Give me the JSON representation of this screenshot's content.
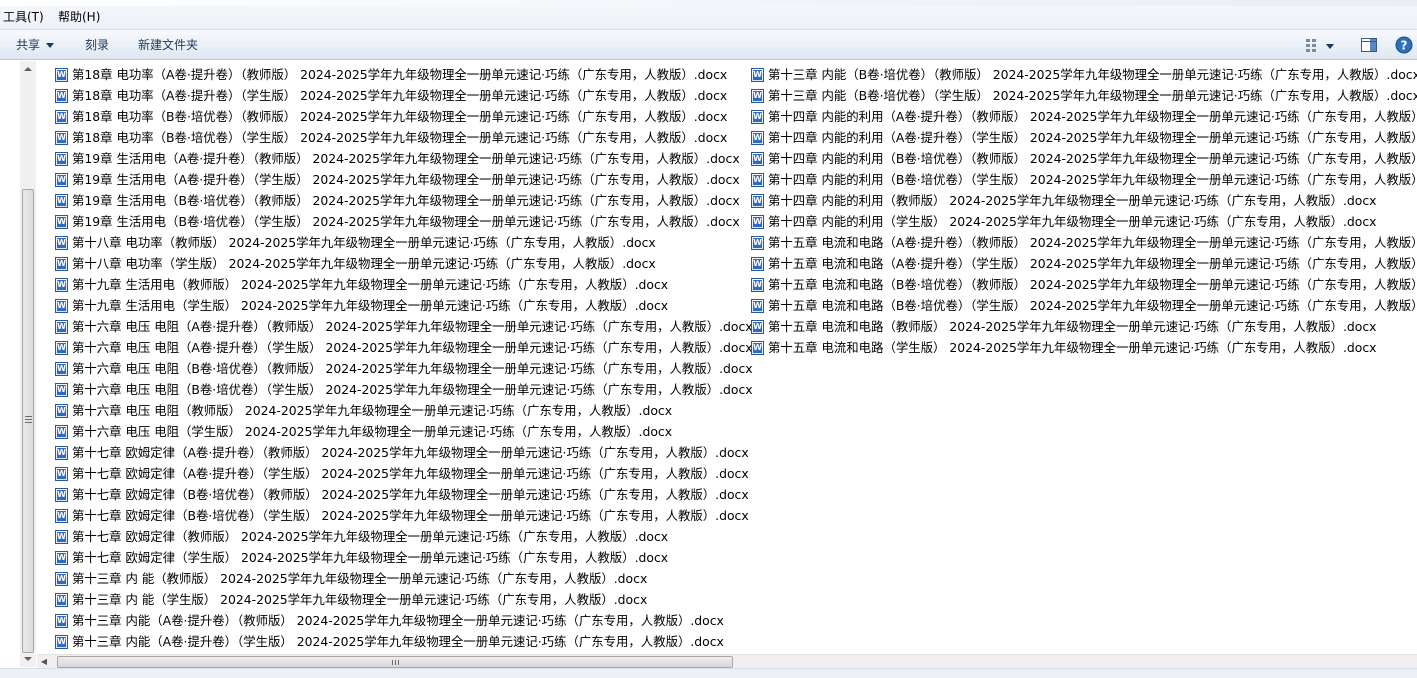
{
  "menubar": {
    "tools": "工具(T)",
    "help": "帮助(H)"
  },
  "toolbar": {
    "share": "共享",
    "burn": "刻录",
    "new_folder": "新建文件夹"
  },
  "icons": {
    "file": "word-document-icon",
    "view": "view-options-icon",
    "preview": "preview-pane-icon",
    "help": "help-icon"
  },
  "colors": {
    "toolbar_text": "#1e395b",
    "help_icon": "#2f6fb8",
    "word_icon": "#2b6cc4"
  },
  "files": {
    "col1": [
      "第18章 电功率（A卷·提升卷）（教师版） 2024-2025学年九年级物理全一册单元速记·巧练（广东专用，人教版）.docx",
      "第18章 电功率（A卷·提升卷）（学生版） 2024-2025学年九年级物理全一册单元速记·巧练（广东专用，人教版）.docx",
      "第18章 电功率（B卷·培优卷）（教师版） 2024-2025学年九年级物理全一册单元速记·巧练（广东专用，人教版）.docx",
      "第18章 电功率（B卷·培优卷）（学生版） 2024-2025学年九年级物理全一册单元速记·巧练（广东专用，人教版）.docx",
      "第19章 生活用电（A卷·提升卷）（教师版） 2024-2025学年九年级物理全一册单元速记·巧练（广东专用，人教版）.docx",
      "第19章 生活用电（A卷·提升卷）（学生版） 2024-2025学年九年级物理全一册单元速记·巧练（广东专用，人教版）.docx",
      "第19章 生活用电（B卷·培优卷）（教师版） 2024-2025学年九年级物理全一册单元速记·巧练（广东专用，人教版）.docx",
      "第19章 生活用电（B卷·培优卷）（学生版） 2024-2025学年九年级物理全一册单元速记·巧练（广东专用，人教版）.docx",
      "第十八章 电功率（教师版） 2024-2025学年九年级物理全一册单元速记·巧练（广东专用，人教版）.docx",
      "第十八章 电功率（学生版） 2024-2025学年九年级物理全一册单元速记·巧练（广东专用，人教版）.docx",
      "第十九章 生活用电（教师版） 2024-2025学年九年级物理全一册单元速记·巧练（广东专用，人教版）.docx",
      "第十九章 生活用电（学生版） 2024-2025学年九年级物理全一册单元速记·巧练（广东专用，人教版）.docx",
      "第十六章 电压 电阻（A卷·提升卷）（教师版） 2024-2025学年九年级物理全一册单元速记·巧练（广东专用，人教版）.docx",
      "第十六章 电压 电阻（A卷·提升卷）（学生版） 2024-2025学年九年级物理全一册单元速记·巧练（广东专用，人教版）.docx",
      "第十六章 电压 电阻（B卷·培优卷）（教师版） 2024-2025学年九年级物理全一册单元速记·巧练（广东专用，人教版）.docx",
      "第十六章 电压 电阻（B卷·培优卷）（学生版） 2024-2025学年九年级物理全一册单元速记·巧练（广东专用，人教版）.docx",
      "第十六章 电压 电阻（教师版） 2024-2025学年九年级物理全一册单元速记·巧练（广东专用，人教版）.docx",
      "第十六章 电压 电阻（学生版） 2024-2025学年九年级物理全一册单元速记·巧练（广东专用，人教版）.docx",
      "第十七章 欧姆定律（A卷·提升卷）（教师版） 2024-2025学年九年级物理全一册单元速记·巧练（广东专用，人教版）.docx",
      "第十七章 欧姆定律（A卷·提升卷）（学生版） 2024-2025学年九年级物理全一册单元速记·巧练（广东专用，人教版）.docx",
      "第十七章 欧姆定律（B卷·培优卷）（教师版） 2024-2025学年九年级物理全一册单元速记·巧练（广东专用，人教版）.docx",
      "第十七章 欧姆定律（B卷·培优卷）（学生版） 2024-2025学年九年级物理全一册单元速记·巧练（广东专用，人教版）.docx",
      "第十七章 欧姆定律（教师版） 2024-2025学年九年级物理全一册单元速记·巧练（广东专用，人教版）.docx",
      "第十七章 欧姆定律（学生版） 2024-2025学年九年级物理全一册单元速记·巧练（广东专用，人教版）.docx",
      "第十三章 内 能（教师版） 2024-2025学年九年级物理全一册单元速记·巧练（广东专用，人教版）.docx",
      "第十三章 内 能（学生版） 2024-2025学年九年级物理全一册单元速记·巧练（广东专用，人教版）.docx",
      "第十三章 内能（A卷·提升卷）（教师版） 2024-2025学年九年级物理全一册单元速记·巧练（广东专用，人教版）.docx",
      "第十三章 内能（A卷·提升卷）（学生版） 2024-2025学年九年级物理全一册单元速记·巧练（广东专用，人教版）.docx"
    ],
    "col2": [
      "第十三章 内能（B卷·培优卷）（教师版） 2024-2025学年九年级物理全一册单元速记·巧练（广东专用，人教版）.docx",
      "第十三章 内能（B卷·培优卷）（学生版） 2024-2025学年九年级物理全一册单元速记·巧练（广东专用，人教版）.docx",
      "第十四章 内能的利用（A卷·提升卷）（教师版） 2024-2025学年九年级物理全一册单元速记·巧练（广东专用，人教版）.d",
      "第十四章 内能的利用（A卷·提升卷）（学生版） 2024-2025学年九年级物理全一册单元速记·巧练（广东专用，人教版）.d",
      "第十四章 内能的利用（B卷·培优卷）（教师版） 2024-2025学年九年级物理全一册单元速记·巧练（广东专用，人教版）.d",
      "第十四章 内能的利用（B卷·培优卷）（学生版） 2024-2025学年九年级物理全一册单元速记·巧练（广东专用，人教版）.d",
      "第十四章 内能的利用（教师版） 2024-2025学年九年级物理全一册单元速记·巧练（广东专用，人教版）.docx",
      "第十四章 内能的利用（学生版） 2024-2025学年九年级物理全一册单元速记·巧练（广东专用，人教版）.docx",
      "第十五章 电流和电路（A卷·提升卷）（教师版） 2024-2025学年九年级物理全一册单元速记·巧练（广东专用，人教版）.d",
      "第十五章 电流和电路（A卷·提升卷）（学生版） 2024-2025学年九年级物理全一册单元速记·巧练（广东专用，人教版）.d",
      "第十五章 电流和电路（B卷·培优卷）（教师版） 2024-2025学年九年级物理全一册单元速记·巧练（广东专用，人教版）.d",
      "第十五章 电流和电路（B卷·培优卷）（学生版） 2024-2025学年九年级物理全一册单元速记·巧练（广东专用，人教版）.d",
      "第十五章 电流和电路（教师版） 2024-2025学年九年级物理全一册单元速记·巧练（广东专用，人教版）.docx",
      "第十五章 电流和电路（学生版） 2024-2025学年九年级物理全一册单元速记·巧练（广东专用，人教版）.docx"
    ]
  }
}
